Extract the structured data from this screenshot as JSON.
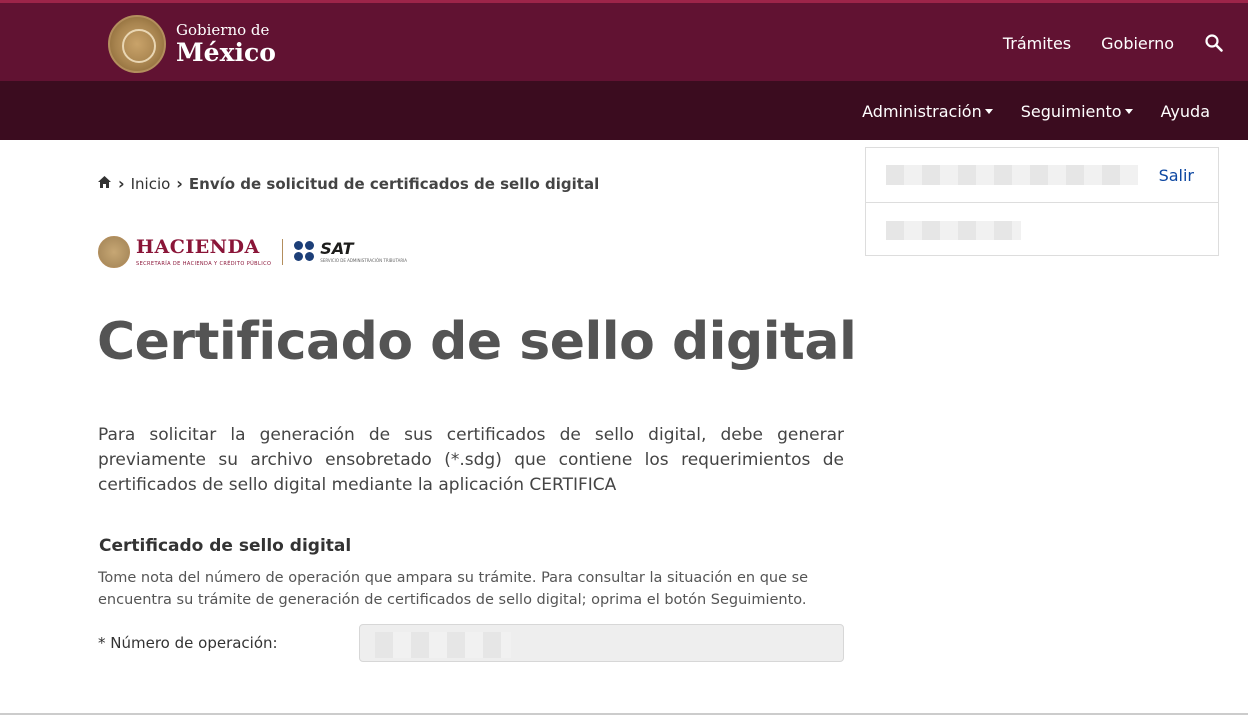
{
  "header": {
    "logo_line1": "Gobierno de",
    "logo_line2": "México",
    "nav": [
      "Trámites",
      "Gobierno"
    ],
    "search_icon": "search-icon",
    "colors": {
      "primary": "#611232",
      "secondary": "#3b0c1f"
    }
  },
  "subnav": {
    "items": [
      "Administración",
      "Seguimiento",
      "Ayuda"
    ]
  },
  "breadcrumb": {
    "home_icon": "home-icon",
    "inicio": "Inicio",
    "current": "Envío de solicitud de certificados de sello digital"
  },
  "userbox": {
    "salir": "Salir"
  },
  "brands": {
    "hacienda": "HACIENDA",
    "hacienda_sub": "SECRETARÍA DE HACIENDA Y CRÉDITO PÚBLICO",
    "sat": "SAT",
    "sat_sub": "SERVICIO DE ADMINISTRACIÓN TRIBUTARIA"
  },
  "main": {
    "title": "Certificado de sello digital",
    "intro": "Para solicitar la generación de sus certificados de sello digital, debe generar previamente su archivo ensobretado (*.sdg) que contiene los requerimientos de certificados de sello digital mediante la aplicación CERTIFICA",
    "section_title": "Certificado de sello digital",
    "note": "Tome nota del número de operación que ampara su trámite. Para consultar la situación en que se encuentra su trámite de generación de certificados de sello digital; oprima el botón Seguimiento.",
    "field_label": "* Número de operación:"
  }
}
